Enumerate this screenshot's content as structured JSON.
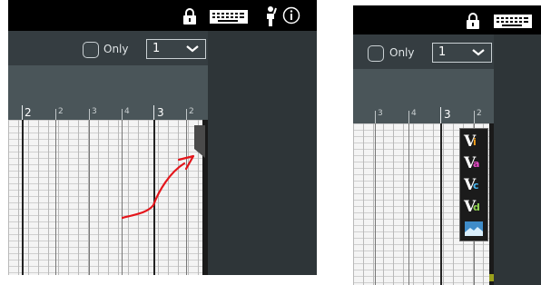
{
  "left_panel": {
    "only_label": "Only",
    "select_value": "1",
    "ruler_labels": [
      {
        "text": "2",
        "major": true
      },
      {
        "text": "2",
        "major": false
      },
      {
        "text": "3",
        "major": false
      },
      {
        "text": "4",
        "major": false
      },
      {
        "text": "3",
        "major": true
      },
      {
        "text": "2",
        "major": false
      }
    ],
    "icons": [
      "lock-icon",
      "keyboard-icon",
      "hand-raised-icon",
      "info-icon"
    ],
    "annotation": {
      "type": "red-arrow",
      "color": "#e4151b"
    }
  },
  "right_panel": {
    "only_label": "Only",
    "select_value": "1",
    "ruler_labels": [
      {
        "text": "3",
        "major": false
      },
      {
        "text": "4",
        "major": false
      },
      {
        "text": "3",
        "major": true
      },
      {
        "text": "2",
        "major": false
      }
    ],
    "icons": [
      "lock-icon",
      "keyboard-icon"
    ],
    "velocity_menu": [
      {
        "letter": "V",
        "sub": "i",
        "sub_color": "#f5a01c"
      },
      {
        "letter": "V",
        "sub": "a",
        "sub_color": "#e94ac8"
      },
      {
        "letter": "V",
        "sub": "c",
        "sub_color": "#49b8f2"
      },
      {
        "letter": "V",
        "sub": "d",
        "sub_color": "#8fd14f"
      }
    ]
  },
  "colors": {
    "topbar": "#000000",
    "toolbar": "#353d41",
    "ruler": "#4a5559",
    "accent_red": "#e4151b"
  }
}
